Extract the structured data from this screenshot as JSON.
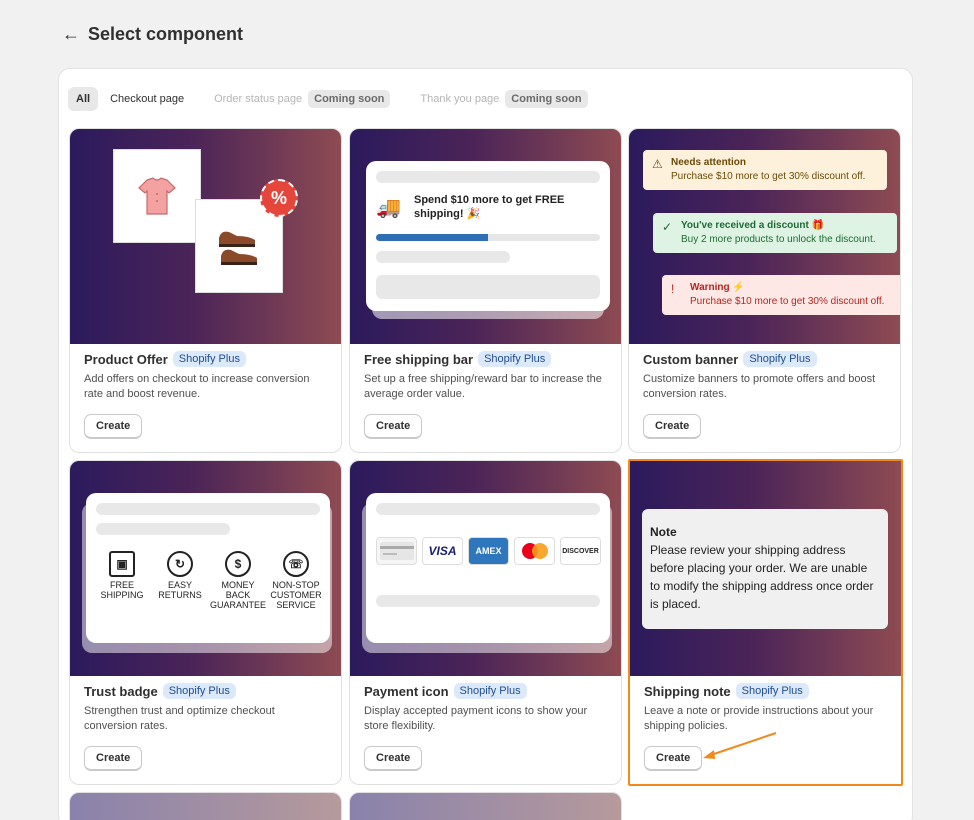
{
  "header": {
    "back_icon": "arrow-left-icon",
    "title": "Select component"
  },
  "tabs": [
    {
      "label": "All",
      "state": "active"
    },
    {
      "label": "Checkout page",
      "state": "enabled"
    },
    {
      "label": "Order status page",
      "state": "disabled",
      "badge": "Coming soon"
    },
    {
      "label": "Thank you page",
      "state": "disabled",
      "badge": "Coming soon"
    }
  ],
  "cards": [
    {
      "title": "Product Offer",
      "badge": "Shopify Plus",
      "description": "Add offers on checkout to increase conversion rate and boost revenue.",
      "button": "Create"
    },
    {
      "title": "Free shipping bar",
      "badge": "Shopify Plus",
      "description": "Set up a free shipping/reward bar to increase the average order value.",
      "button": "Create",
      "preview": {
        "message": "Spend $10 more to get FREE shipping! 🎉",
        "progress": 0.5
      }
    },
    {
      "title": "Custom banner",
      "badge": "Shopify Plus",
      "description": "Customize banners to promote offers and boost conversion rates.",
      "button": "Create",
      "preview": {
        "warning": {
          "title": "Needs attention",
          "text": "Purchase $10 more to get 30% discount off."
        },
        "success": {
          "title": "You've received a discount 🎁",
          "text": "Buy 2 more products to unlock the discount."
        },
        "error": {
          "title": "Warning ⚡",
          "text": "Purchase $10 more to get 30% discount off."
        }
      }
    },
    {
      "title": "Trust badge",
      "badge": "Shopify Plus",
      "description": "Strengthen trust and optimize checkout conversion rates.",
      "button": "Create",
      "preview": {
        "items": [
          "FREE SHIPPING",
          "EASY RETURNS",
          "MONEY BACK GUARANTEE",
          "NON-STOP CUSTOMER SERVICE"
        ]
      }
    },
    {
      "title": "Payment icon",
      "badge": "Shopify Plus",
      "description": "Display accepted payment icons to show your store flexibility.",
      "button": "Create",
      "preview": {
        "icons": [
          "generic-card",
          "VISA",
          "AMEX",
          "mastercard",
          "DISCOVER"
        ]
      }
    },
    {
      "title": "Shipping note",
      "badge": "Shopify Plus",
      "description": "Leave a note or provide instructions about your shipping policies.",
      "button": "Create",
      "selected": true,
      "preview": {
        "note_title": "Note",
        "note_text": "Please review your shipping address before placing your order. We are unable to modify the shipping address once order is placed."
      }
    }
  ],
  "colors": {
    "accent_highlight": "#f08a1c",
    "badge_bg": "#dbe9fb",
    "hero_start": "#2b1a5c",
    "hero_end": "#8e4b52"
  }
}
